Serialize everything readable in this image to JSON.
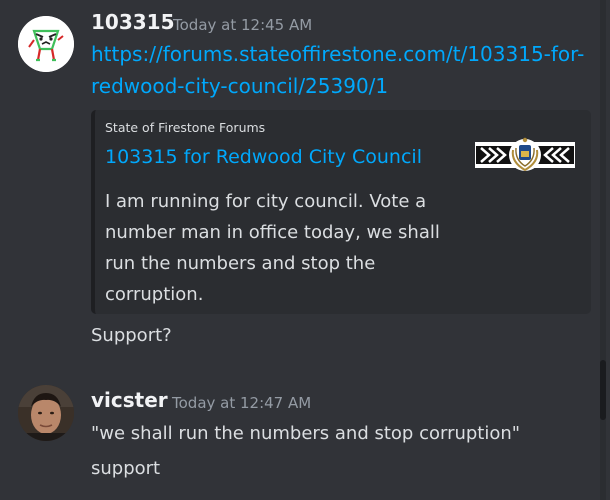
{
  "messages": [
    {
      "username": "103315",
      "timestamp": "Today at 12:45 AM",
      "link": "https://forums.stateoffirestone.com/t/103315-for-redwood-city-council/25390/1",
      "embed": {
        "provider": "State of Firestone Forums",
        "title": "103315 for Redwood City Council",
        "description": "I am running for city council. Vote a number man in office today, we shall run the numbers and stop the corruption."
      },
      "text": "Support?"
    },
    {
      "username": "vicster",
      "timestamp": "Today at 12:47 AM",
      "lines": [
        "\"we shall run the numbers and stop corruption\"",
        "support"
      ]
    }
  ],
  "colors": {
    "background": "#313338",
    "embed_background": "#2b2d31",
    "link": "#00a8fc",
    "username": "#f2f3f5",
    "timestamp": "#949ba4",
    "text": "#dbdee1"
  }
}
